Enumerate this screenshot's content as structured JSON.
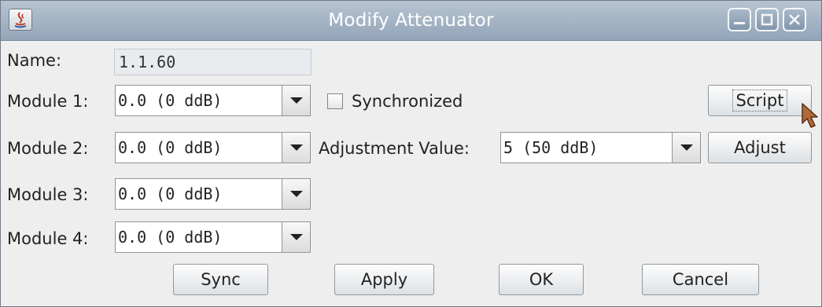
{
  "window": {
    "title": "Modify Attenuator",
    "icons": [
      "java-icon",
      "minimize-icon",
      "maximize-icon",
      "close-icon"
    ]
  },
  "name": {
    "label": "Name:",
    "value": "1.1.60"
  },
  "modules": [
    {
      "label": "Module 1:",
      "value": "0.0 (0 ddB)"
    },
    {
      "label": "Module 2:",
      "value": "0.0 (0 ddB)"
    },
    {
      "label": "Module 3:",
      "value": "0.0 (0 ddB)"
    },
    {
      "label": "Module 4:",
      "value": "0.0 (0 ddB)"
    }
  ],
  "synchronized": {
    "label": "Synchronized",
    "checked": false
  },
  "adjustment": {
    "label": "Adjustment Value:",
    "value": "5 (50 ddB)"
  },
  "buttons": {
    "script": "Script",
    "adjust": "Adjust",
    "sync": "Sync",
    "apply": "Apply",
    "ok": "OK",
    "cancel": "Cancel"
  },
  "colors": {
    "titlebar": "#a5b5c6",
    "background": "#eeeeee",
    "cursor": "#b06a3a"
  }
}
